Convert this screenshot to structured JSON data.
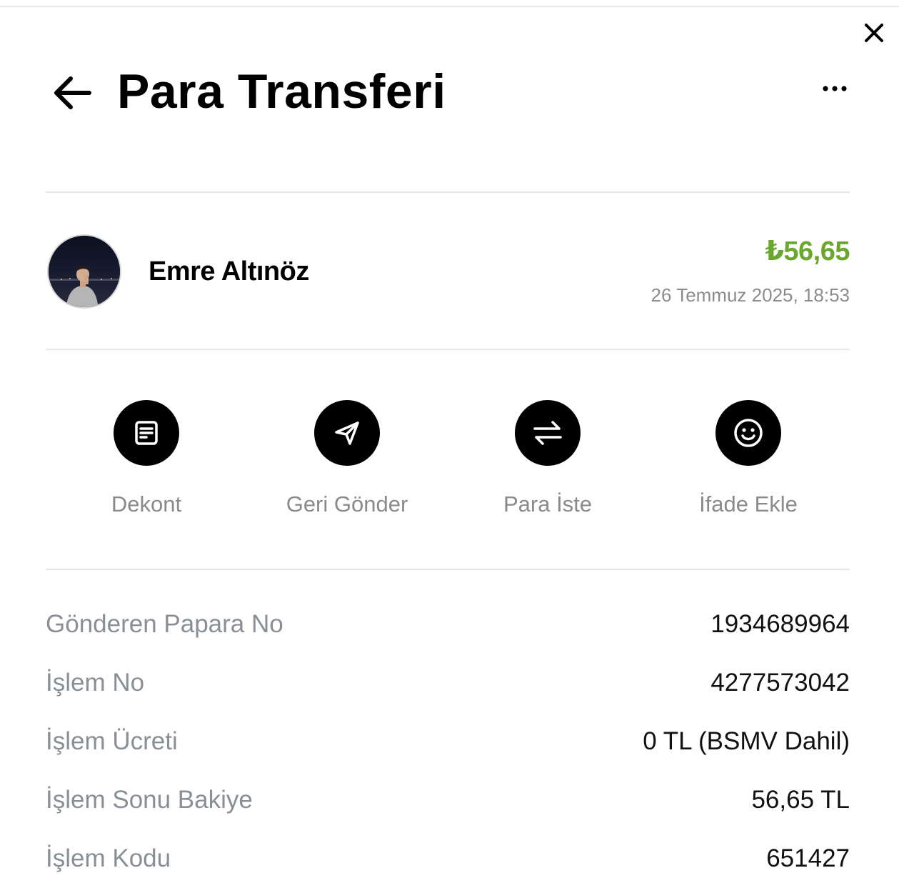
{
  "header": {
    "title": "Para Transferi",
    "back_icon": "arrow-left-icon",
    "more_icon": "more-horizontal-icon",
    "close_icon": "close-icon"
  },
  "transaction": {
    "name": "Emre Altınöz",
    "amount": "₺56,65",
    "datetime": "26 Temmuz 2025, 18:53",
    "amount_color": "#6aa82d"
  },
  "actions": [
    {
      "label": "Dekont",
      "icon": "receipt-icon"
    },
    {
      "label": "Geri Gönder",
      "icon": "send-icon"
    },
    {
      "label": "Para İste",
      "icon": "swap-arrows-icon"
    },
    {
      "label": "İfade Ekle",
      "icon": "smiley-icon"
    }
  ],
  "details": [
    {
      "label": "Gönderen Papara No",
      "value": "1934689964"
    },
    {
      "label": "İşlem No",
      "value": "4277573042"
    },
    {
      "label": "İşlem Ücreti",
      "value": "0 TL (BSMV Dahil)"
    },
    {
      "label": "İşlem Sonu Bakiye",
      "value": "56,65 TL"
    },
    {
      "label": "İşlem Kodu",
      "value": "651427"
    }
  ]
}
